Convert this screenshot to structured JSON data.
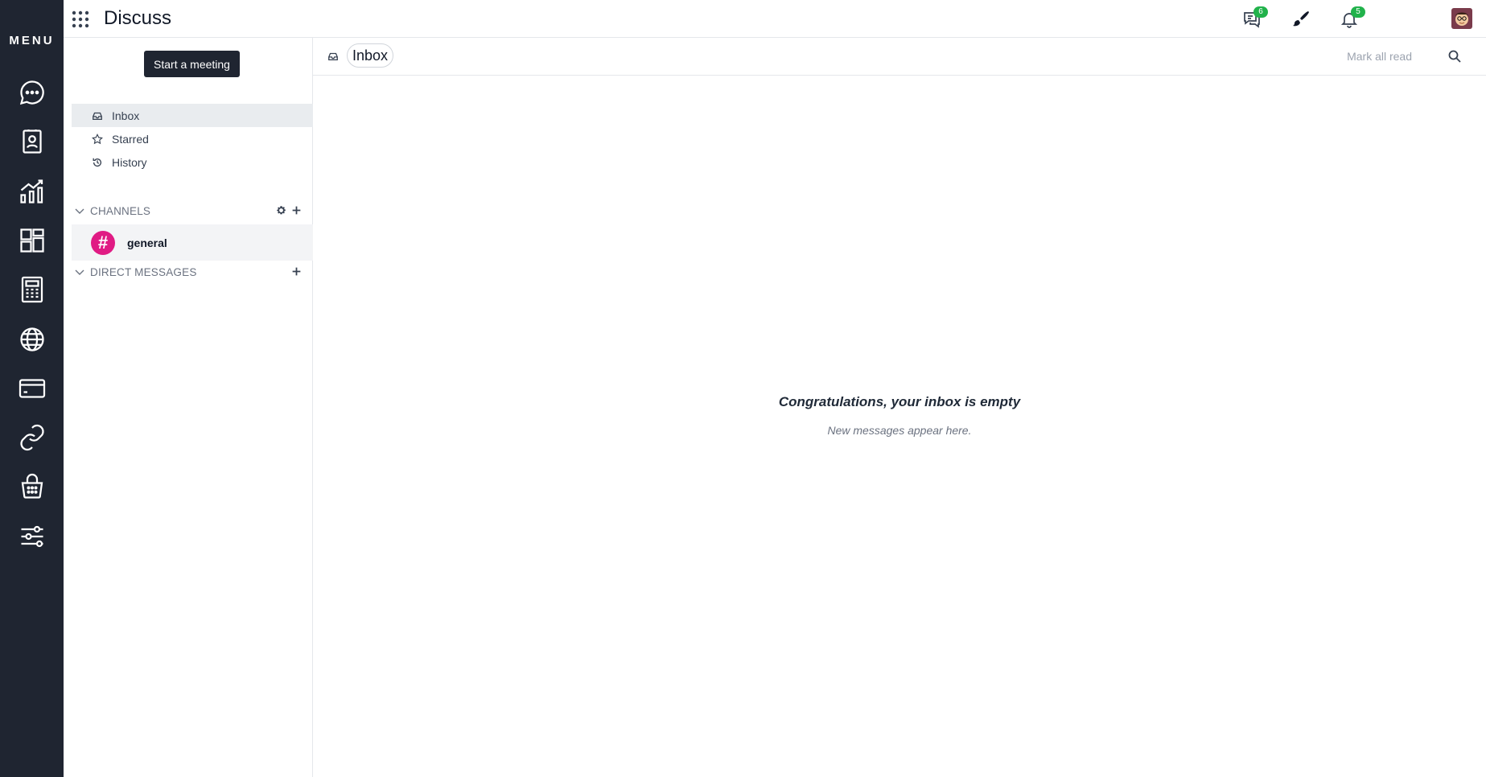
{
  "rail": {
    "title": "MENU",
    "items": [
      {
        "icon": "chat-bubble-icon"
      },
      {
        "icon": "contacts-icon"
      },
      {
        "icon": "chart-icon"
      },
      {
        "icon": "dashboard-icon"
      },
      {
        "icon": "calculator-icon"
      },
      {
        "icon": "globe-icon"
      },
      {
        "icon": "card-icon"
      },
      {
        "icon": "link-icon"
      },
      {
        "icon": "basket-icon"
      },
      {
        "icon": "settings-sliders-icon"
      }
    ]
  },
  "topbar": {
    "title": "Discuss",
    "messages_badge": "6",
    "activity_badge": "5"
  },
  "sidebar": {
    "meeting_button": "Start a meeting",
    "nav": [
      {
        "label": "Inbox"
      },
      {
        "label": "Starred"
      },
      {
        "label": "History"
      }
    ],
    "channels_header": "CHANNELS",
    "channels": [
      {
        "symbol": "#",
        "name": "general"
      }
    ],
    "dm_header": "DIRECT MESSAGES"
  },
  "main": {
    "header_label": "Inbox",
    "mark_all_read": "Mark all read",
    "empty_title": "Congratulations, your inbox is empty",
    "empty_sub": "New messages appear here."
  },
  "colors": {
    "rail_bg": "#1f2531",
    "badge": "#21b24b",
    "channel_avatar": "#e01b84"
  }
}
